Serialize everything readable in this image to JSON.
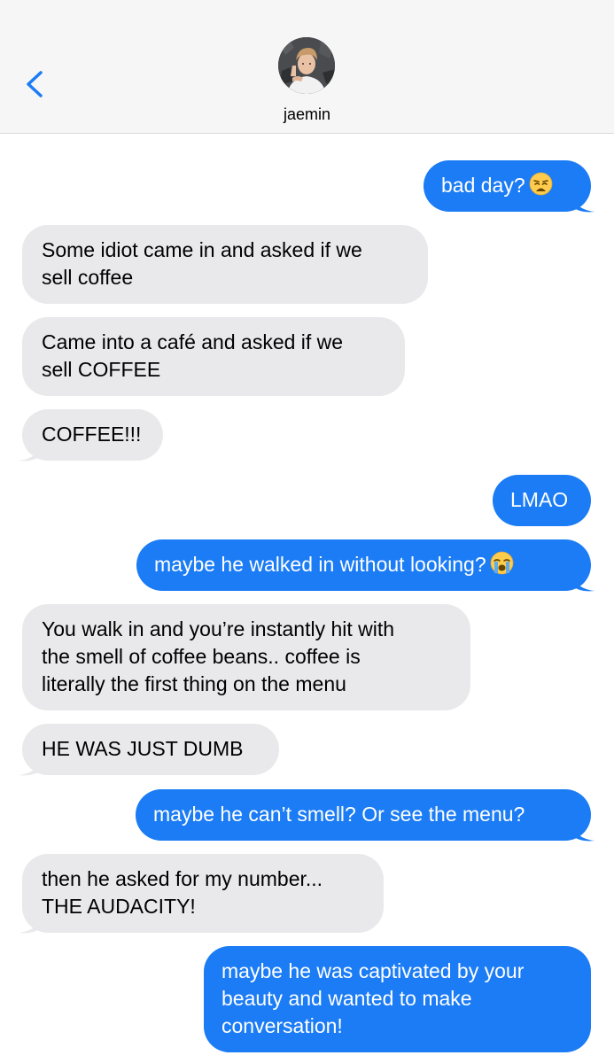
{
  "header": {
    "contact_name": "jaemin",
    "back_icon": "chevron-left-icon",
    "accent_color": "#1b7cf5"
  },
  "colors": {
    "sent_bubble": "#1b7cf5",
    "received_bubble": "#e9e9eb",
    "header_bg": "#f6f6f6"
  },
  "messages": [
    {
      "direction": "sent",
      "text": "bad day?",
      "emoji": "weary-face-icon"
    },
    {
      "direction": "received",
      "lines": [
        "Some idiot came in and asked if we",
        "sell coffee"
      ]
    },
    {
      "direction": "received",
      "lines": [
        "Came into a café and asked if we",
        "sell COFFEE"
      ]
    },
    {
      "direction": "received",
      "text": "COFFEE!!!"
    },
    {
      "direction": "sent",
      "text": "LMAO"
    },
    {
      "direction": "sent",
      "text": "maybe he walked in without looking?",
      "emoji": "loudly-crying-face-icon"
    },
    {
      "direction": "received",
      "lines": [
        "You walk in and you’re instantly hit with",
        "the smell of coffee beans.. coffee is",
        "literally the first thing on the menu"
      ]
    },
    {
      "direction": "received",
      "text": "HE WAS JUST DUMB"
    },
    {
      "direction": "sent",
      "text": "maybe he can’t smell? Or see the menu?"
    },
    {
      "direction": "received",
      "lines": [
        "then he asked for my number...",
        "THE AUDACITY!"
      ]
    },
    {
      "direction": "sent",
      "lines": [
        "maybe he was captivated by your",
        "beauty and wanted to make",
        "conversation!"
      ]
    }
  ]
}
